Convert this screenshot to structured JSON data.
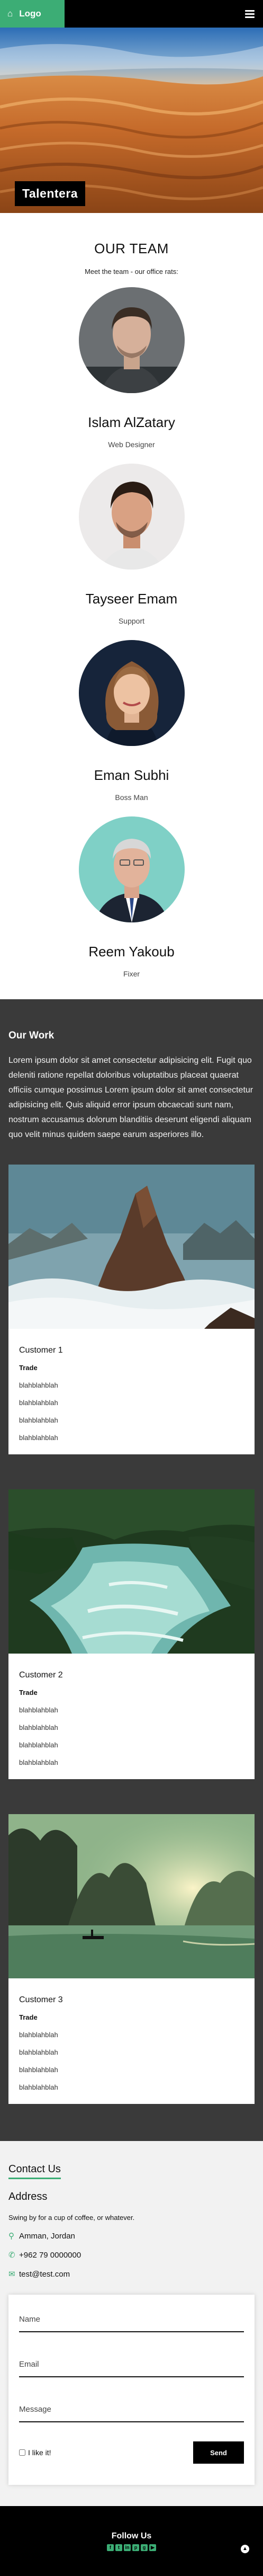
{
  "nav": {
    "logo": "Logo",
    "home_icon": "home-icon",
    "menu_icon": "hamburger-icon"
  },
  "hero": {
    "title": "Talentera"
  },
  "team": {
    "title": "OUR TEAM",
    "subtitle": "Meet the team - our office rats:",
    "members": [
      {
        "name": "Islam AlZatary",
        "role": "Web Designer"
      },
      {
        "name": "Tayseer Emam",
        "role": "Support"
      },
      {
        "name": "Eman Subhi",
        "role": "Boss Man"
      },
      {
        "name": "Reem Yakoub",
        "role": "Fixer"
      }
    ]
  },
  "work": {
    "title": "Our Work",
    "text": "Lorem ipsum dolor sit amet consectetur adipisicing elit. Fugit quo deleniti ratione repellat doloribus voluptatibus placeat quaerat officiis cumque possimus Lorem ipsum dolor sit amet consectetur adipisicing elit. Quis aliquid error ipsum obcaecati sunt nam, nostrum accusamus dolorum blanditiis deserunt eligendi aliquam quo velit minus quidem saepe earum asperiores illo.",
    "cards": [
      {
        "customer": "Customer 1",
        "trade": "Trade",
        "lines": [
          "blahblahblah",
          "blahblahblah",
          "blahblahblah",
          "blahblahblah"
        ]
      },
      {
        "customer": "Customer 2",
        "trade": "Trade",
        "lines": [
          "blahblahblah",
          "blahblahblah",
          "blahblahblah",
          "blahblahblah"
        ]
      },
      {
        "customer": "Customer 3",
        "trade": "Trade",
        "lines": [
          "blahblahblah",
          "blahblahblah",
          "blahblahblah",
          "blahblahblah"
        ]
      }
    ]
  },
  "contact": {
    "title": "Contact Us",
    "address_heading": "Address",
    "slogan": "Swing by for a cup of coffee, or whatever.",
    "location": "Amman, Jordan",
    "phone": "+962 79 0000000",
    "email": "test@test.com",
    "form": {
      "name_placeholder": "Name",
      "email_placeholder": "Email",
      "message_placeholder": "Message",
      "checkbox_label": "I like it!",
      "send_label": "Send"
    }
  },
  "footer": {
    "follow": "Follow Us",
    "socials": [
      "f",
      "t",
      "in",
      "p",
      "g",
      "▶"
    ]
  },
  "colors": {
    "accent": "#3cad75",
    "nav_bg": "#000000",
    "work_bg": "#3a3a3a",
    "contact_bg": "#f2f2f2"
  }
}
